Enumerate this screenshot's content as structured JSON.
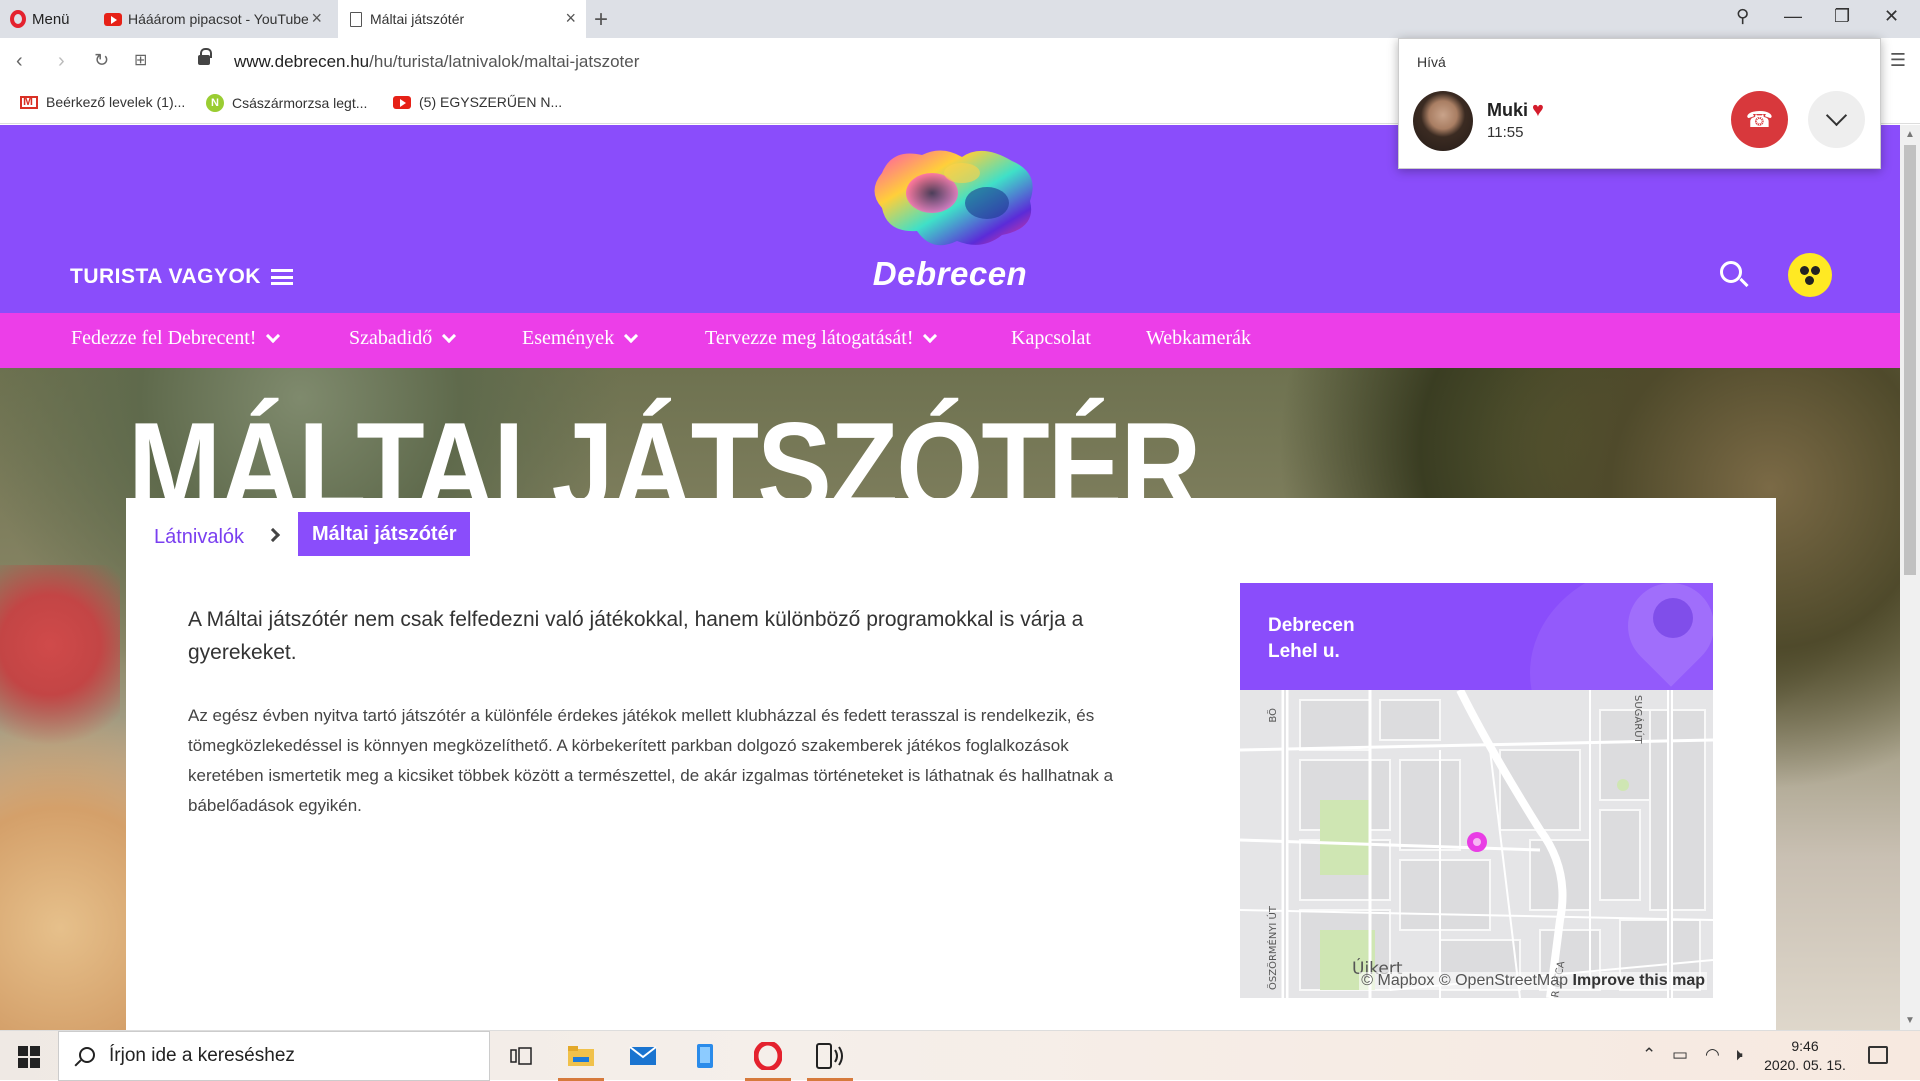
{
  "browser": {
    "menu_label": "Menü",
    "tabs": [
      {
        "title": "Hááárom pipacsot - YouTube",
        "active": false
      },
      {
        "title": "Máltai játszótér",
        "active": true
      }
    ],
    "url_host": "www.debrecen.hu",
    "url_path": "/hu/turista/latnivalok/maltai-jatszoter",
    "bookmarks": [
      {
        "label": "Beérkező levelek (1)...",
        "icon": "gmail-icon"
      },
      {
        "label": "Császármorzsa legt...",
        "icon": "n-icon"
      },
      {
        "label": "(5) EGYSZERŰEN N...",
        "icon": "youtube-icon"
      }
    ]
  },
  "call_popup": {
    "title": "Hívá",
    "caller_name": "Muki",
    "duration": "11:55"
  },
  "site": {
    "section_label": "TURISTA VAGYOK",
    "logo_text": "Debrecen",
    "nav": [
      {
        "label": "Fedezze fel Debrecent!",
        "has_dropdown": true
      },
      {
        "label": "Szabadidő",
        "has_dropdown": true
      },
      {
        "label": "Események",
        "has_dropdown": true
      },
      {
        "label": "Tervezze meg látogatását!",
        "has_dropdown": true
      },
      {
        "label": "Kapcsolat",
        "has_dropdown": false
      },
      {
        "label": "Webkamerák",
        "has_dropdown": false
      }
    ],
    "page_title": "MÁLTAI JÁTSZÓTÉR",
    "breadcrumb": {
      "parent": "Látnivalók",
      "current": "Máltai játszótér"
    },
    "lead": "A Máltai játszótér nem csak felfedezni való játékokkal, hanem különböző programokkal is várja a gyerekeket.",
    "body": "Az egész évben nyitva tartó játszótér a különféle érdekes játékok mellett klubházzal és fedett terasszal is rendelkezik, és tömegközlekedéssel is könnyen megközelíthető.  A körbekerített parkban dolgozó szakemberek játékos foglalkozások keretében ismertetik meg a kicsiket többek között a természettel, de akár izgalmas történeteket is láthatnak és hallhatnak a bábelőadások egyikén.",
    "map": {
      "city": "Debrecen",
      "street": "Lehel u.",
      "labels": [
        "BÖ",
        "ÖSZÖRMÉNYI ÚT",
        "SUGÁRÚT",
        "R UTCA",
        "Újkert"
      ],
      "attribution": "© Mapbox © OpenStreetMap",
      "improve_link": "Improve this map",
      "colors": {
        "pin": "#e93de5",
        "park": "#cfe6b3",
        "road": "#ffffff",
        "block": "#dedee0"
      }
    },
    "colors": {
      "purple": "#8a4dfb",
      "magenta": "#ec3ee8",
      "yellow": "#ffe923"
    }
  },
  "taskbar": {
    "search_placeholder": "Írjon ide a kereséshez",
    "time": "9:46",
    "date": "2020. 05. 15."
  }
}
